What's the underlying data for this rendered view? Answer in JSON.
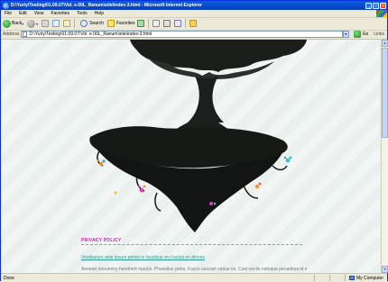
{
  "window": {
    "title": "D:\\Yuriy\\Testing\\01.09.07\\Vol. e.00L_Ranum\\site\\index-3.html - Microsoft Internet Explorer"
  },
  "menu": {
    "items": [
      "File",
      "Edit",
      "View",
      "Favorites",
      "Tools",
      "Help"
    ]
  },
  "toolbar": {
    "back_label": "Back",
    "search_label": "Search",
    "favorites_label": "Favorites"
  },
  "address": {
    "label": "Address",
    "value": "D:\\Yuriy\\Testing\\01.09.07\\Vol. e.00L_Ranum\\site\\index-3.html",
    "go_label": "Go",
    "links_label": "Links"
  },
  "page": {
    "section_title": "PRIVACY POLICY",
    "link_text": "Vestibulum ante ipsum primis in faucibus orci luctus et ultrices",
    "body_text": "Aenean nonummy hendrerit mauris. Phasellus porta. Fusce suscipit varius mi. Cum sociis natoque penatibus et magnis dis"
  },
  "status": {
    "text": "Done",
    "zone_label": "My Computer"
  },
  "colors": {
    "accent": "#c42aa8",
    "link": "#2a9a8a",
    "title_bar": "#0b48c8"
  },
  "icons": [
    "ie-logo-icon",
    "back-icon",
    "forward-icon",
    "stop-icon",
    "refresh-icon",
    "home-icon",
    "search-icon",
    "favorites-icon",
    "media-icon",
    "mail-icon",
    "print-icon",
    "edit-icon",
    "folder-icon",
    "go-icon",
    "computer-icon"
  ]
}
